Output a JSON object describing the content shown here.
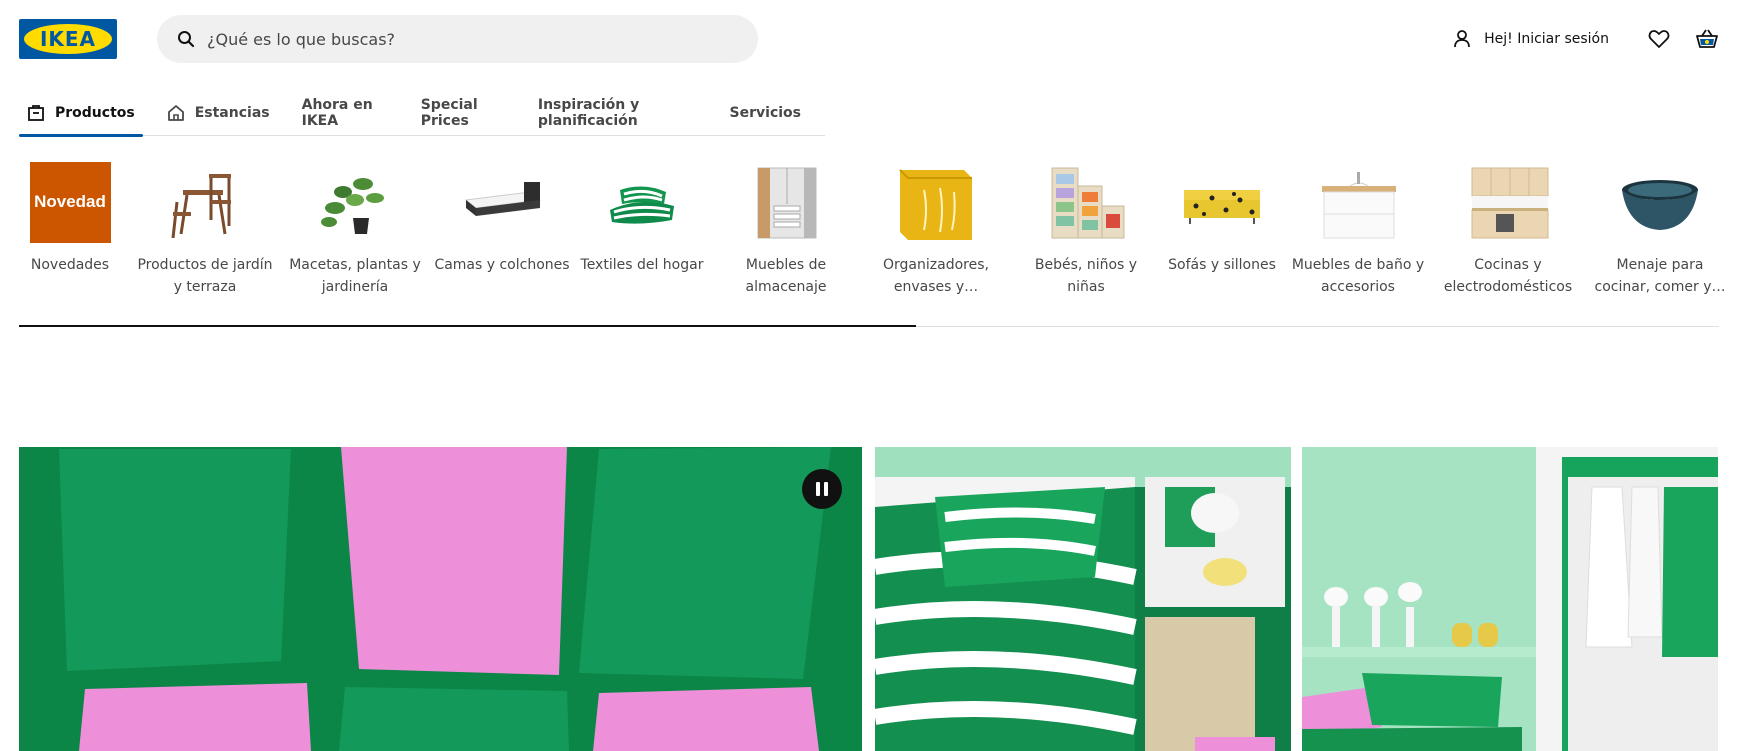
{
  "header": {
    "logo_text": "IKEA",
    "search_placeholder": "¿Qué es lo que buscas?",
    "login_label": "Hej! Iniciar sesión",
    "icons": [
      "search-icon",
      "user-icon",
      "heart-icon",
      "cart-icon"
    ]
  },
  "tabs": [
    {
      "label": "Productos",
      "icon": "bag-icon",
      "active": true
    },
    {
      "label": "Estancias",
      "icon": "home-icon",
      "active": false
    },
    {
      "label": "Ahora en IKEA",
      "active": false
    },
    {
      "label": "Special Prices",
      "active": false
    },
    {
      "label": "Inspiración y planificación",
      "active": false
    },
    {
      "label": "Servicios",
      "active": false
    }
  ],
  "categories": [
    {
      "label": "Novedades",
      "badge": "Novedad"
    },
    {
      "label": "Productos de jardín y terraza"
    },
    {
      "label": "Macetas, plantas y jardinería"
    },
    {
      "label": "Camas y colchones"
    },
    {
      "label": "Textiles del hogar"
    },
    {
      "label": "Muebles de almacenaje"
    },
    {
      "label": "Organizadores, envases y…"
    },
    {
      "label": "Bebés, niños y niñas"
    },
    {
      "label": "Sofás y sillones"
    },
    {
      "label": "Muebles de baño y accesorios"
    },
    {
      "label": "Cocinas y electrodomésticos"
    },
    {
      "label": "Menaje para cocinar, comer y…"
    }
  ],
  "colors": {
    "brand_blue": "#0058a3",
    "brand_yellow": "#ffdb00",
    "novedad_orange": "#cc5500",
    "hero_green": "#0c8a48",
    "pillow_pink": "#ee8fd9"
  }
}
